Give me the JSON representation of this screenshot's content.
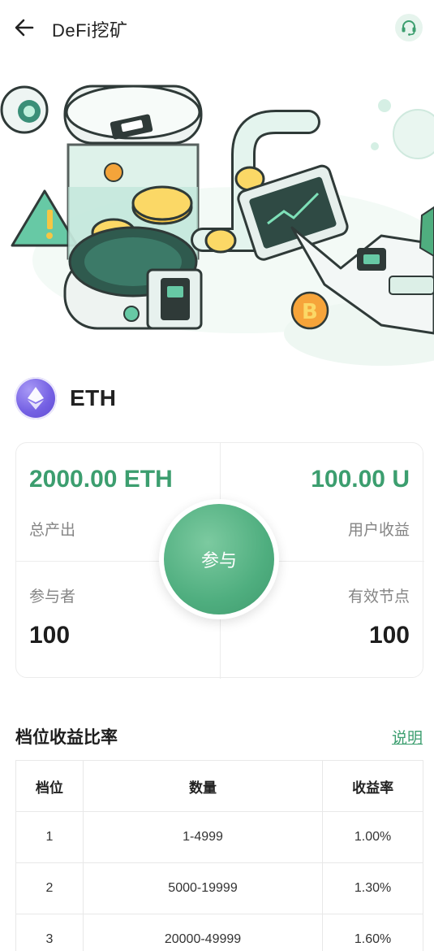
{
  "header": {
    "title": "DeFi挖矿",
    "back_icon": "arrow-left-icon",
    "support_icon": "headset-icon"
  },
  "coin": {
    "name": "ETH",
    "icon": "ethereum-icon",
    "icon_color": "#7460e3"
  },
  "stats": {
    "total_output_value": "2000.00 ETH",
    "total_output_label": "总产出",
    "user_income_value": "100.00 U",
    "user_income_label": "用户收益",
    "participants_label": "参与者",
    "participants_value": "100",
    "valid_nodes_label": "有效节点",
    "valid_nodes_value": "100"
  },
  "join_button": {
    "label": "参与"
  },
  "tiers": {
    "title": "档位收益比率",
    "link": "说明",
    "columns": [
      "档位",
      "数量",
      "收益率"
    ],
    "rows": [
      [
        "1",
        "1-4999",
        "1.00%"
      ],
      [
        "2",
        "5000-19999",
        "1.30%"
      ],
      [
        "3",
        "20000-49999",
        "1.60%"
      ]
    ]
  },
  "colors": {
    "accent": "#3c9e6f",
    "join_gradient": "#4fae7f",
    "coin_purple": "#7460e3"
  }
}
